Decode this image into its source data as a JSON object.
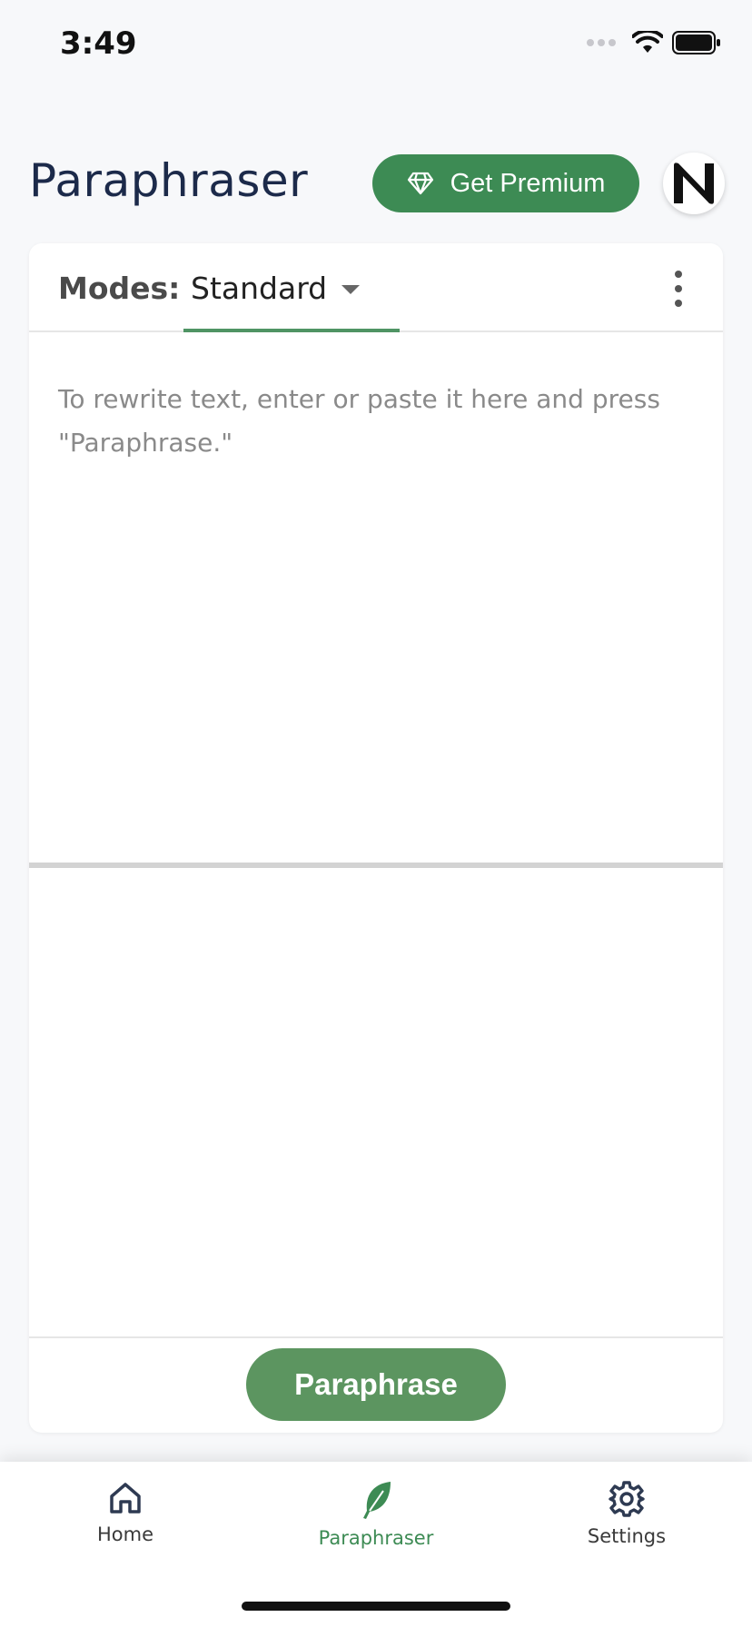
{
  "status_bar": {
    "time": "3:49"
  },
  "header": {
    "title": "Paraphraser",
    "premium_label": "Get Premium",
    "avatar_letter": "N"
  },
  "card": {
    "modes_label": "Modes:",
    "mode_selected": "Standard",
    "input_placeholder": "To rewrite text, enter or paste it here and press \"Paraphrase.\"",
    "paraphrase_label": "Paraphrase"
  },
  "tab_bar": {
    "items": [
      {
        "label": "Home",
        "icon": "home-icon"
      },
      {
        "label": "Paraphraser",
        "icon": "feather-icon",
        "active": true
      },
      {
        "label": "Settings",
        "icon": "gear-icon"
      }
    ]
  },
  "colors": {
    "brand_green": "#3d8b54",
    "button_green": "#5c9560",
    "title_navy": "#1c2a4a"
  }
}
